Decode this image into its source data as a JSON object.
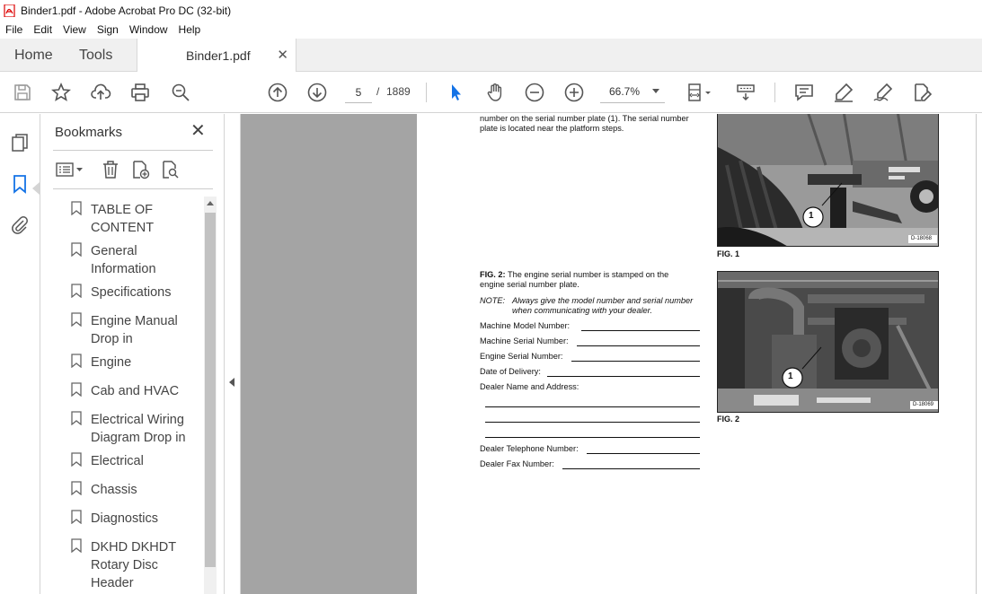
{
  "window": {
    "title": "Binder1.pdf - Adobe Acrobat Pro DC (32-bit)"
  },
  "menu": [
    "File",
    "Edit",
    "View",
    "Sign",
    "Window",
    "Help"
  ],
  "tabs": {
    "home": "Home",
    "tools": "Tools",
    "document": "Binder1.pdf"
  },
  "toolbar": {
    "page_current": "5",
    "page_separator": "/",
    "page_total": "1889",
    "zoom": "66.7%"
  },
  "bookmarks": {
    "header": "Bookmarks",
    "items": [
      "TABLE OF CONTENT",
      "General Information",
      "Specifications",
      "Engine Manual Drop in",
      "Engine",
      "Cab and HVAC",
      "Electrical Wiring Diagram Drop in",
      "Electrical",
      "Chassis",
      "Diagnostics",
      "DKHD DKHDT Rotary Disc Header"
    ]
  },
  "document": {
    "intro_line1": "number on the serial number plate (1). The serial number",
    "intro_line2": "plate is located near the platform steps.",
    "fig2_desc_bold": "FIG. 2:",
    "fig2_desc_rest": " The engine serial number is stamped on the",
    "fig2_desc_line2": "engine serial number plate.",
    "note_label": "NOTE:",
    "note_line1": "Always give the model number and serial number",
    "note_line2": "when communicating with your dealer.",
    "fields": {
      "model": "Machine Model Number:",
      "serial": "Machine Serial Number:",
      "engine_serial": "Engine Serial Number:",
      "delivery": "Date of Delivery:",
      "dealer": "Dealer Name and Address:",
      "telephone": "Dealer Telephone Number:",
      "fax": "Dealer Fax Number:"
    },
    "fig1": {
      "caption": "FIG. 1",
      "callout": "1",
      "ref": "D-18068"
    },
    "fig2": {
      "caption": "FIG. 2",
      "callout": "1",
      "ref": "D-18069"
    }
  }
}
